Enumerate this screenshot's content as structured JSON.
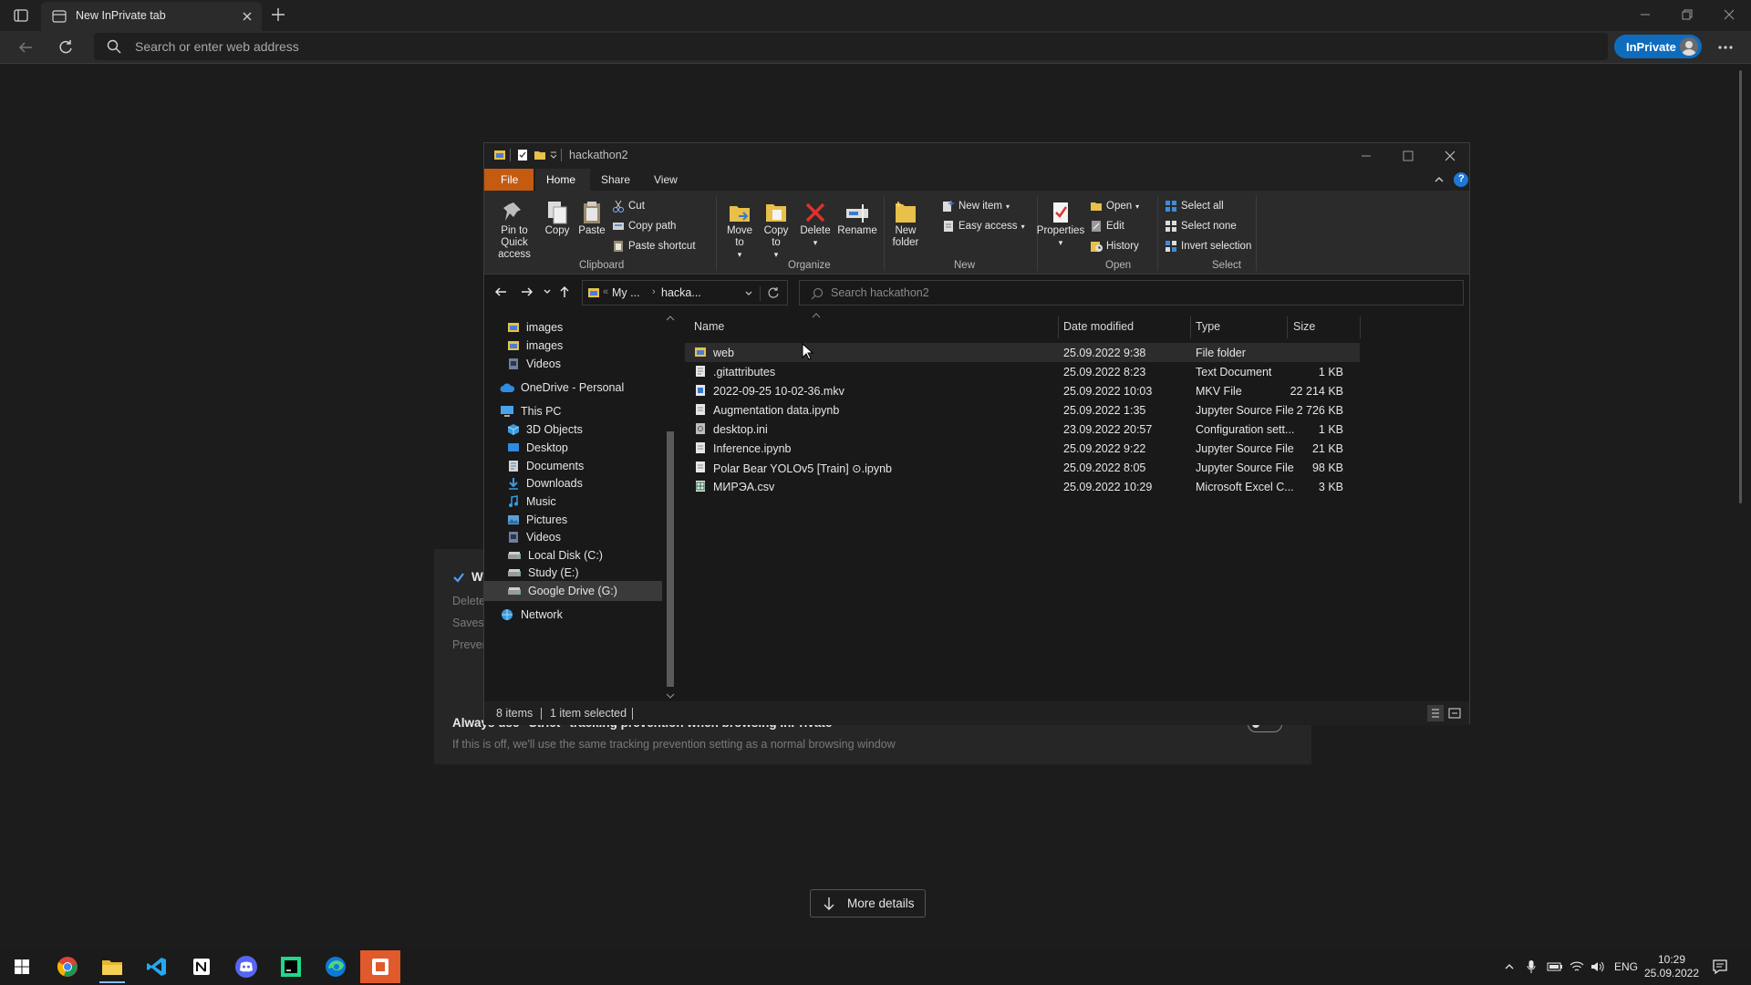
{
  "browser": {
    "tab_title": "New InPrivate tab",
    "address_placeholder": "Search or enter web address",
    "inprivate_label": "InPrivate"
  },
  "background_page": {
    "item1_title": "W",
    "item1_desc": "Delete",
    "item2_desc": "Saves",
    "item3_desc": "Preven",
    "strict_title": "Always use \"Strict\" tracking prevention when browsing InPrivate",
    "strict_desc": "If this is off, we'll use the same tracking prevention setting as a normal browsing window",
    "more_details": "More details"
  },
  "explorer": {
    "title": "hackathon2",
    "tabs": [
      "File",
      "Home",
      "Share",
      "View"
    ],
    "ribbon": {
      "clipboard": {
        "pin": "Pin to Quick access",
        "copy": "Copy",
        "paste": "Paste",
        "cut": "Cut",
        "copy_path": "Copy path",
        "paste_shortcut": "Paste shortcut",
        "group": "Clipboard"
      },
      "organize": {
        "move_to": "Move to",
        "copy_to": "Copy to",
        "delete": "Delete",
        "rename": "Rename",
        "group": "Organize"
      },
      "new": {
        "new_folder": "New folder",
        "new_item": "New item",
        "easy_access": "Easy access",
        "group": "New"
      },
      "open": {
        "properties": "Properties",
        "open": "Open",
        "edit": "Edit",
        "history": "History",
        "group": "Open"
      },
      "select": {
        "select_all": "Select all",
        "select_none": "Select none",
        "invert": "Invert selection",
        "group": "Select"
      }
    },
    "breadcrumb": {
      "part1": "My ...",
      "part2": "hacka..."
    },
    "search_placeholder": "Search hackathon2",
    "nav_items": [
      "images",
      "images",
      "Videos",
      "OneDrive - Personal",
      "This PC",
      "3D Objects",
      "Desktop",
      "Documents",
      "Downloads",
      "Music",
      "Pictures",
      "Videos",
      "Local Disk (C:)",
      "Study (E:)",
      "Google Drive (G:)",
      "Network"
    ],
    "columns": [
      "Name",
      "Date modified",
      "Type",
      "Size"
    ],
    "files": [
      {
        "name": "web",
        "date": "25.09.2022 9:38",
        "type": "File folder",
        "size": ""
      },
      {
        "name": ".gitattributes",
        "date": "25.09.2022 8:23",
        "type": "Text Document",
        "size": "1 KB"
      },
      {
        "name": "2022-09-25 10-02-36.mkv",
        "date": "25.09.2022 10:03",
        "type": "MKV File",
        "size": "22 214 KB"
      },
      {
        "name": "Augmentation data.ipynb",
        "date": "25.09.2022 1:35",
        "type": "Jupyter Source File",
        "size": "2 726 KB"
      },
      {
        "name": "desktop.ini",
        "date": "23.09.2022 20:57",
        "type": "Configuration sett...",
        "size": "1 KB"
      },
      {
        "name": "Inference.ipynb",
        "date": "25.09.2022 9:22",
        "type": "Jupyter Source File",
        "size": "21 KB"
      },
      {
        "name": "Polar Bear  YOLOv5 [Train] ⊙.ipynb",
        "date": "25.09.2022 8:05",
        "type": "Jupyter Source File",
        "size": "98 KB"
      },
      {
        "name": "МИРЭА.csv",
        "date": "25.09.2022 10:29",
        "type": "Microsoft Excel C...",
        "size": "3 KB"
      }
    ],
    "status": {
      "items": "8 items",
      "selected": "1 item selected"
    }
  },
  "taskbar": {
    "lang": "ENG",
    "time": "10:29",
    "date": "25.09.2022"
  },
  "colors": {
    "accent_blue": "#0f6cbd",
    "file_tab": "#c55a11",
    "taskbar_active": "#e05a2b"
  }
}
